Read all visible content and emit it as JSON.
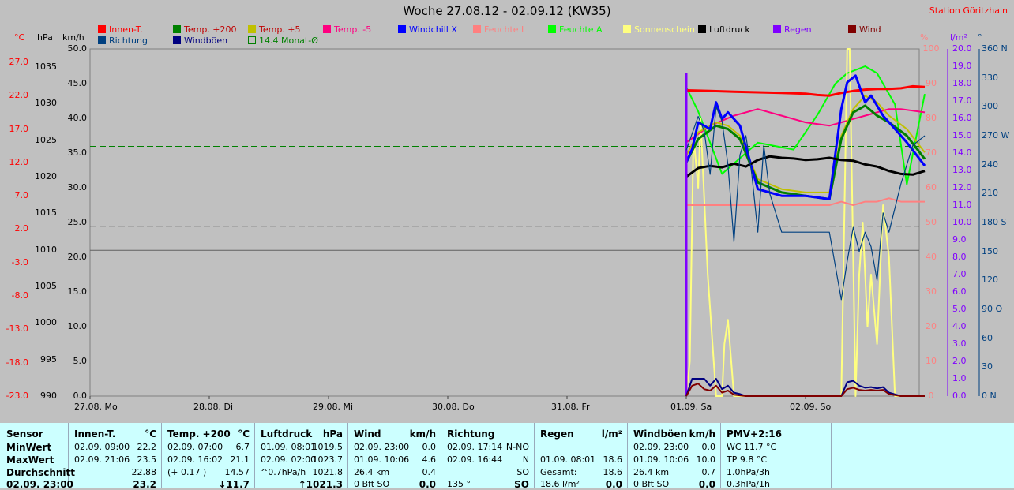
{
  "title": "Woche 27.08.12 - 02.09.12 (KW35)",
  "station": "Station Göritzhain",
  "units": {
    "temp": "°C",
    "press": "hPa",
    "wind": "km/h",
    "hum": "%",
    "rain": "l/m²",
    "dir": "°"
  },
  "legend": [
    {
      "label": "Innen-T.",
      "color": "#ff0000"
    },
    {
      "label": "Temp. +200",
      "color": "#008000"
    },
    {
      "label": "Temp. +5",
      "color": "#c0c000"
    },
    {
      "label": "Temp. -5",
      "color": "#ff0080"
    },
    {
      "label": "Windchill X",
      "color": "#0000ff"
    },
    {
      "label": "Feuchte I",
      "color": "#ff8080"
    },
    {
      "label": "Feuchte A",
      "color": "#00ff00"
    },
    {
      "label": "Sonnenschein",
      "color": "#ffff80"
    },
    {
      "label": "Luftdruck",
      "color": "#000000"
    },
    {
      "label": "Regen",
      "color": "#8000ff"
    },
    {
      "label": "Wind",
      "color": "#800000"
    },
    {
      "label": "Richtung",
      "color": "#004080"
    },
    {
      "label": "Windböen",
      "color": "#000080"
    },
    {
      "label": "14.4 Monat-Ø",
      "color": "#008000"
    }
  ],
  "chart_data": {
    "type": "line",
    "x_ticks": [
      "27.08. Mo",
      "28.08. Di",
      "29.08. Mi",
      "30.08. Do",
      "31.08. Fr",
      "01.09. Sa",
      "02.09. So"
    ],
    "axes": {
      "temp_ticks": [
        "27.0",
        "22.0",
        "17.0",
        "12.0",
        "7.0",
        "2.0",
        "-3.0",
        "-8.0",
        "-13.0",
        "-18.0",
        "-23.0"
      ],
      "press_ticks": [
        "1035",
        "1030",
        "1025",
        "1020",
        "1015",
        "1010",
        "1005",
        "1000",
        "995",
        "990"
      ],
      "wind_ticks": [
        "50.0",
        "45.0",
        "40.0",
        "35.0",
        "30.0",
        "25.0",
        "20.0",
        "15.0",
        "10.0",
        "5.0",
        "0.0"
      ],
      "hum_ticks": [
        "100",
        "90",
        "80",
        "70",
        "60",
        "50",
        "40",
        "30",
        "20",
        "10",
        "0"
      ],
      "rain_ticks": [
        "20.0",
        "19.0",
        "18.0",
        "17.0",
        "16.0",
        "15.0",
        "14.0",
        "13.0",
        "12.0",
        "11.0",
        "10.0",
        "9.0",
        "8.0",
        "7.0",
        "6.0",
        "5.0",
        "4.0",
        "3.0",
        "2.0",
        "1.0",
        "0.0"
      ],
      "dir_ticks": [
        "360 N",
        "330",
        "300",
        "270 W",
        "240",
        "210",
        "180 S",
        "150",
        "120",
        "90 O",
        "60",
        "30",
        "0 N"
      ]
    },
    "ranges": {
      "hum": [
        0,
        100
      ],
      "temp": [
        -23,
        29
      ],
      "press": [
        990,
        1037.5
      ],
      "wind": [
        0,
        50
      ],
      "rain": [
        0,
        20
      ],
      "dir": [
        0,
        360
      ]
    },
    "reference_lines": {
      "monthly_avg_temp": 14.4,
      "pressure_ref": 1013.25,
      "wind_ref": 21
    },
    "series": [
      {
        "name": "Feuchte A",
        "axis": "hum",
        "x": [
          5.0,
          5.1,
          5.3,
          5.6,
          5.9,
          6.1,
          6.25,
          6.35,
          6.5,
          6.6,
          6.75,
          6.85,
          7.0
        ],
        "y": [
          89,
          82,
          64,
          73,
          71,
          81,
          90,
          93,
          95,
          93,
          84,
          61,
          87
        ]
      },
      {
        "name": "Sonnenschein",
        "axis": "hum",
        "x": [
          5.0,
          5.03,
          5.06,
          5.1,
          5.12,
          5.18,
          5.25,
          5.3,
          5.32,
          5.35,
          5.4,
          5.5,
          5.6,
          5.8,
          6.0,
          6.2,
          6.3,
          6.35,
          6.37,
          6.42,
          6.45,
          6.48,
          6.52,
          6.55,
          6.6,
          6.65,
          6.7,
          6.75,
          6.85,
          7.0
        ],
        "y": [
          0,
          10,
          75,
          60,
          80,
          35,
          0,
          0,
          15,
          22,
          0,
          0,
          0,
          0,
          0,
          0,
          0,
          100,
          100,
          0,
          35,
          50,
          20,
          35,
          15,
          55,
          40,
          0,
          0,
          0
        ]
      },
      {
        "name": "Innen-T.",
        "axis": "temp",
        "x": [
          5.0,
          5.2,
          5.4,
          5.6,
          5.8,
          6.0,
          6.1,
          6.2,
          6.3,
          6.4,
          6.5,
          6.6,
          6.7,
          6.8,
          6.9,
          7.0
        ],
        "y": [
          22.8,
          22.7,
          22.6,
          22.5,
          22.4,
          22.3,
          22.1,
          22.0,
          22.4,
          22.7,
          22.9,
          23.0,
          23.0,
          23.1,
          23.4,
          23.3
        ]
      },
      {
        "name": "Temp. -5",
        "axis": "temp",
        "x": [
          5.0,
          5.2,
          5.4,
          5.6,
          5.8,
          6.0,
          6.2,
          6.3,
          6.4,
          6.5,
          6.6,
          6.7,
          6.8,
          7.0
        ],
        "y": [
          15.0,
          17.5,
          19.0,
          20.0,
          19.0,
          18.0,
          17.5,
          18.0,
          18.5,
          19.0,
          19.5,
          20.0,
          20.0,
          19.5
        ]
      },
      {
        "name": "Temp. +5",
        "axis": "temp",
        "x": [
          5.0,
          5.1,
          5.25,
          5.35,
          5.45,
          5.6,
          5.8,
          6.0,
          6.2,
          6.3,
          6.4,
          6.5,
          6.6,
          6.7,
          6.85,
          7.0
        ],
        "y": [
          13.0,
          16.5,
          18.0,
          17.5,
          16.0,
          9.5,
          8.0,
          7.5,
          7.5,
          16.0,
          20.0,
          22.0,
          21.0,
          19.0,
          17.0,
          13.5
        ]
      },
      {
        "name": "Temp. +200",
        "axis": "temp",
        "x": [
          5.0,
          5.1,
          5.25,
          5.35,
          5.45,
          5.6,
          5.8,
          6.0,
          6.2,
          6.3,
          6.4,
          6.5,
          6.6,
          6.7,
          6.85,
          7.0
        ],
        "y": [
          12.0,
          15.5,
          17.5,
          17.0,
          15.5,
          9.0,
          7.5,
          7.0,
          6.5,
          15.5,
          19.5,
          20.5,
          19.0,
          18.0,
          16.0,
          12.5
        ]
      },
      {
        "name": "Windchill X",
        "axis": "temp",
        "x": [
          5.0,
          5.05,
          5.1,
          5.2,
          5.25,
          5.3,
          5.35,
          5.45,
          5.6,
          5.8,
          6.0,
          6.2,
          6.3,
          6.35,
          6.42,
          6.5,
          6.55,
          6.65,
          6.75,
          6.85,
          7.0
        ],
        "y": [
          12.0,
          14.0,
          18.0,
          17.0,
          21.0,
          18.5,
          19.5,
          17.5,
          8.0,
          7.0,
          7.0,
          6.5,
          20.0,
          24.0,
          25.0,
          21.0,
          22.0,
          19.0,
          17.0,
          15.0,
          11.5
        ]
      },
      {
        "name": "Feuchte I",
        "axis": "hum",
        "x": [
          5.0,
          5.2,
          5.4,
          5.6,
          5.8,
          6.0,
          6.2,
          6.3,
          6.4,
          6.5,
          6.6,
          6.7,
          6.8,
          7.0
        ],
        "y": [
          55,
          55,
          55,
          55,
          55,
          55,
          55,
          56,
          55,
          56,
          56,
          57,
          56,
          56
        ]
      },
      {
        "name": "Luftdruck",
        "axis": "press",
        "x": [
          5.0,
          5.1,
          5.2,
          5.3,
          5.4,
          5.5,
          5.6,
          5.7,
          5.8,
          5.9,
          6.0,
          6.1,
          6.2,
          6.3,
          6.4,
          6.5,
          6.6,
          6.7,
          6.8,
          6.9,
          7.0
        ],
        "y": [
          1020.0,
          1021.2,
          1021.5,
          1021.3,
          1021.8,
          1021.4,
          1022.3,
          1022.8,
          1022.6,
          1022.5,
          1022.3,
          1022.4,
          1022.6,
          1022.3,
          1022.2,
          1021.7,
          1021.4,
          1020.8,
          1020.4,
          1020.3,
          1020.8
        ]
      },
      {
        "name": "Regen",
        "axis": "rain",
        "x": [
          5.0,
          5.0
        ],
        "y": [
          0,
          18.6
        ]
      },
      {
        "name": "Richtung",
        "axis": "dir",
        "x": [
          5.0,
          5.1,
          5.15,
          5.2,
          5.25,
          5.3,
          5.35,
          5.4,
          5.45,
          5.5,
          5.55,
          5.6,
          5.65,
          5.7,
          5.8,
          6.0,
          6.2,
          6.3,
          6.35,
          6.4,
          6.45,
          6.5,
          6.55,
          6.6,
          6.65,
          6.7,
          6.8,
          6.9,
          7.0
        ],
        "y": [
          255,
          290,
          275,
          230,
          300,
          285,
          240,
          160,
          250,
          270,
          230,
          170,
          260,
          210,
          170,
          170,
          170,
          100,
          140,
          175,
          150,
          170,
          155,
          120,
          190,
          170,
          220,
          260,
          270
        ]
      },
      {
        "name": "Windböen",
        "axis": "wind",
        "x": [
          5.0,
          5.05,
          5.1,
          5.15,
          5.2,
          5.25,
          5.3,
          5.35,
          5.4,
          5.45,
          5.5,
          5.6,
          5.8,
          6.0,
          6.2,
          6.3,
          6.35,
          6.4,
          6.45,
          6.5,
          6.55,
          6.6,
          6.65,
          6.7,
          6.8,
          7.0
        ],
        "y": [
          0,
          2.5,
          2.5,
          2.5,
          1.5,
          2.5,
          1.0,
          1.5,
          0.5,
          0.3,
          0,
          0,
          0,
          0,
          0,
          0,
          2.0,
          2.2,
          1.5,
          1.2,
          1.3,
          1.1,
          1.3,
          0.5,
          0,
          0
        ]
      },
      {
        "name": "Wind",
        "axis": "wind",
        "x": [
          5.0,
          5.05,
          5.1,
          5.15,
          5.2,
          5.25,
          5.3,
          5.35,
          5.4,
          5.45,
          5.5,
          5.6,
          5.8,
          6.0,
          6.2,
          6.3,
          6.35,
          6.4,
          6.45,
          6.5,
          6.55,
          6.6,
          6.65,
          6.7,
          6.8,
          7.0
        ],
        "y": [
          0,
          1.5,
          1.8,
          1.0,
          0.8,
          1.5,
          0.5,
          0.8,
          0.2,
          0.1,
          0,
          0,
          0,
          0,
          0,
          0,
          1.0,
          1.2,
          0.9,
          0.8,
          0.9,
          0.8,
          0.9,
          0.3,
          0,
          0
        ]
      }
    ]
  },
  "table": {
    "sensor": {
      "h": "Sensor",
      "r1": "MinWert",
      "r2": "MaxWert",
      "r3": "Durchschnitt",
      "r4": "02.09. 23:00"
    },
    "cols": [
      {
        "h": "Innen-T.",
        "u": "°C",
        "r1a": "02.09. 09:00",
        "r1b": "22.2",
        "r2a": "02.09. 21:06",
        "r2b": "23.5",
        "r3a": "",
        "r3b": "22.88",
        "r4": "23.2"
      },
      {
        "h": "Temp. +200",
        "u": "°C",
        "r1a": "02.09. 07:00",
        "r1b": "6.7",
        "r2a": "02.09. 16:02",
        "r2b": "21.1",
        "r3a": "(+ 0.17 )",
        "r3b": "14.57",
        "r4": "↓11.7"
      },
      {
        "h": "Luftdruck",
        "u": "hPa",
        "r1a": "01.09. 08:01",
        "r1b": "1019.5",
        "r2a": "02.09. 02:00",
        "r2b": "1023.7",
        "r3a": "^0.7hPa/h",
        "r3b": "1021.8",
        "r4": "↑1021.3"
      },
      {
        "h": "Wind",
        "u": "km/h",
        "r1a": "02.09. 23:00",
        "r1b": "0.0",
        "r2a": "01.09. 10:06",
        "r2b": "4.6",
        "r3a": "26.4 km",
        "r3b": "0.4",
        "r4a": "0 Bft SO",
        "r4": "0.0"
      },
      {
        "h": "Richtung",
        "u": "",
        "r1a": "02.09. 17:14",
        "r1b": "N-NO",
        "r2a": "02.09. 16:44",
        "r2b": "N",
        "r3a": "",
        "r3b": "SO",
        "r4a": "135 °",
        "r4": "SO"
      },
      {
        "h": "Regen",
        "u": "l/m²",
        "r1a": "",
        "r1b": "",
        "r2a": "01.09. 08:01",
        "r2b": "18.6",
        "r3a": "Gesamt:",
        "r3b": "18.6",
        "r4a": "18.6 l/m²",
        "r4": "0.0"
      },
      {
        "h": "Windböen",
        "u": "km/h",
        "r1a": "02.09. 23:00",
        "r1b": "0.0",
        "r2a": "01.09. 10:06",
        "r2b": "10.0",
        "r3a": "26.4 km",
        "r3b": "0.7",
        "r4a": "0 Bft SO",
        "r4": "0.0"
      },
      {
        "h": "PMV+2:16",
        "u": "",
        "r1a": "WC 11.7 °C",
        "r1b": "",
        "r2a": "TP 9.8 °C",
        "r2b": "",
        "r3a": "1.0hPa/3h",
        "r3b": "",
        "r4a": "0.3hPa/1h",
        "r4": ""
      }
    ]
  }
}
